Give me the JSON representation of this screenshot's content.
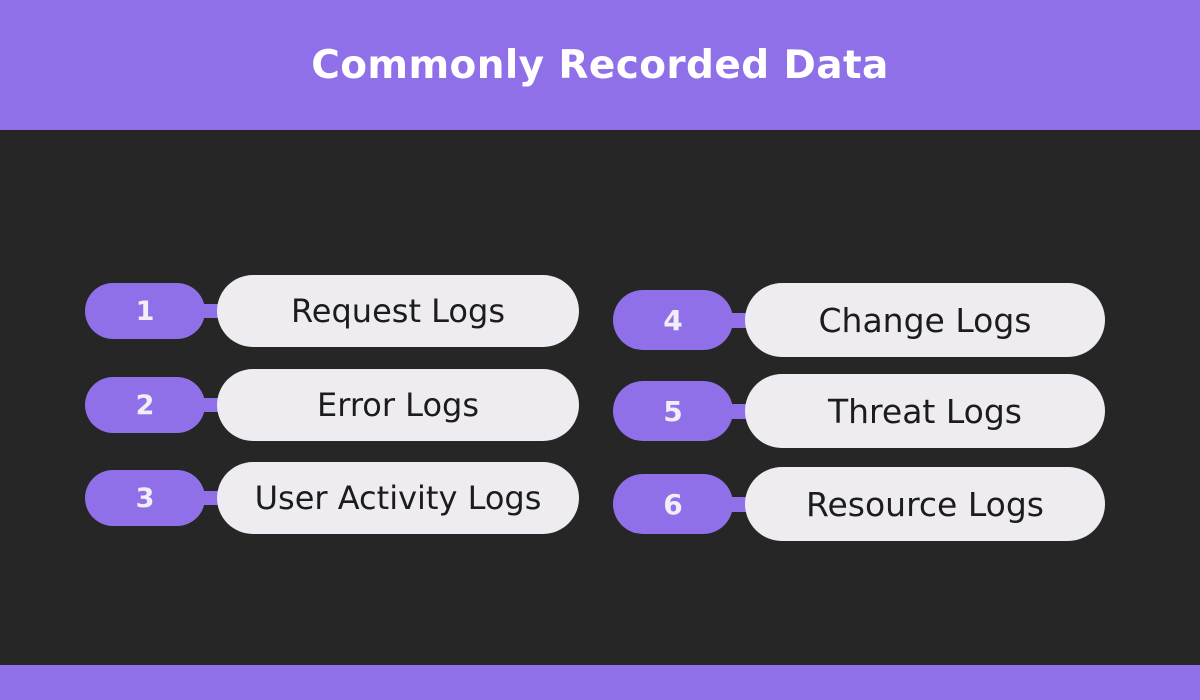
{
  "header": {
    "title": "Commonly Recorded Data",
    "background_color": "#8f70e9",
    "text_color": "#ffffff"
  },
  "footer": {
    "background_color": "#8f70e9"
  },
  "theme": {
    "page_background": "#262626",
    "accent_purple": "#8f70e9",
    "pill_background": "#eeecf1",
    "pill_text": "#1c1c1c",
    "number_text": "#f1eef8"
  },
  "items": [
    {
      "number": "1",
      "label": "Request Logs"
    },
    {
      "number": "2",
      "label": "Error Logs"
    },
    {
      "number": "3",
      "label": "User Activity Logs"
    },
    {
      "number": "4",
      "label": "Change Logs"
    },
    {
      "number": "5",
      "label": "Threat Logs"
    },
    {
      "number": "6",
      "label": "Resource Logs"
    }
  ]
}
